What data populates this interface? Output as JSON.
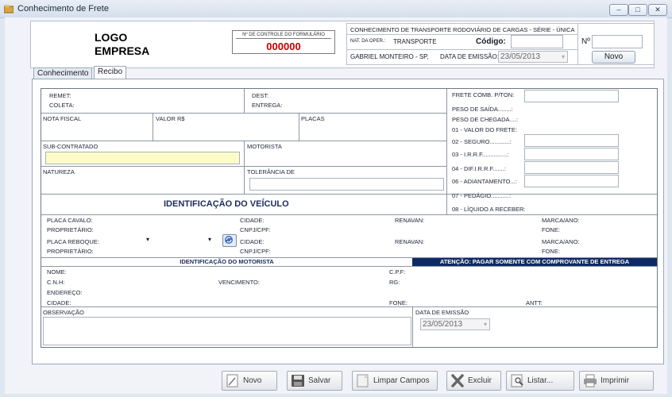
{
  "window": {
    "title": "Conhecimento de Frete",
    "minimize": "–",
    "maximize": "□",
    "close": "✕"
  },
  "header": {
    "logo_line1": "LOGO",
    "logo_line2": "EMPRESA",
    "control_label": "Nº DE CONTROLE DO FORMULÁRIO",
    "control_number": "000000",
    "cte_title": "CONHECIMENTO DE TRANSPORTE RODOVIÁRIO DE CARGAS - SÉRIE - ÚNICA",
    "nat_oper_label": "NAT. DA OPER.:",
    "nat_oper_value": "TRANSPORTE",
    "codigo_label": "Código:",
    "origin": "GABRIEL MONTEIRO - SP,",
    "data_emissao_label": "DATA DE EMISSÃO:",
    "data_emissao_value": "23/05/2013",
    "numero_label": "Nº",
    "novo_button": "Novo"
  },
  "tabs": [
    {
      "label": "Conhecimento"
    },
    {
      "label": "Recibo"
    }
  ],
  "form": {
    "remet": "REMET:",
    "dest": "DEST:",
    "coleta": "COLETA:",
    "entrega": "ENTREGA:",
    "nota_fiscal": "NOTA FISCAL",
    "valor": "VALOR R$",
    "placas": "PLACAS",
    "sub_contratado": "SUB-CONTRATADO",
    "motorista": "MOTORISTA",
    "natureza": "NATUREZA",
    "tolerancia": "TOLERÂNCIA DE",
    "ident_veiculo": "IDENTIFICAÇÃO DO VEÍCULO",
    "frete_comb": "FRETE COMB. P/TON:",
    "peso_saida": "PESO DE SAÍDA........:",
    "peso_chegada": "PESO DE CHEGADA....:",
    "valor_frete": "01 - VALOR DO FRETE:",
    "seguro": "02 - SEGURO............:",
    "irrf": "03 - I.R.R.F...............:",
    "dif_irrf": "04 - DIF.I.R.R.F.......:",
    "adiantamento": "06 - ADIANTAMENTO...:",
    "pedagio": "07 - PEDÁGIO...........:",
    "liquido": "08 - LÍQUIDO A RECEBER:",
    "placa_cavalo": "PLACA CAVALO:",
    "proprietario": "PROPRIETÁRIO:",
    "cidade": "CIDADE:",
    "cnpj_cpf": "CNPJ/CPF:",
    "renavan": "RENAVAN:",
    "marca_ano": "MARCA/ANO:",
    "fone": "FONE:",
    "placa_reboque": "PLACA REBOQUE:",
    "ident_motorista": "IDENTIFICAÇÃO DO MOTORISTA",
    "atencao": "ATENÇÃO: PAGAR SOMENTE COM COMPROVANTE DE ENTREGA",
    "nome": "NOME:",
    "cpf": "C.P.F:",
    "cnh": "C.N.H:",
    "vencimento": "VENCIMENTO:",
    "rg": "RG:",
    "endereco": "ENDEREÇO:",
    "cidade_motorista": "CIDADE:",
    "fone_motorista": "FONE:",
    "antt": "ANTT:",
    "observacao": "OBSERVAÇÃO",
    "data_emissao": "DATA DE EMISSÃO",
    "data_emissao_value": "23/05/2013"
  },
  "buttons": {
    "novo": "Novo",
    "salvar": "Salvar",
    "limpar": "Limpar Campos",
    "excluir": "Excluir",
    "listar": "Listar...",
    "imprimir": "Imprimir"
  },
  "colors": {
    "accent_dark": "#0e2a66",
    "control_number": "#c00000",
    "highlight_field": "#fdfbc8"
  }
}
